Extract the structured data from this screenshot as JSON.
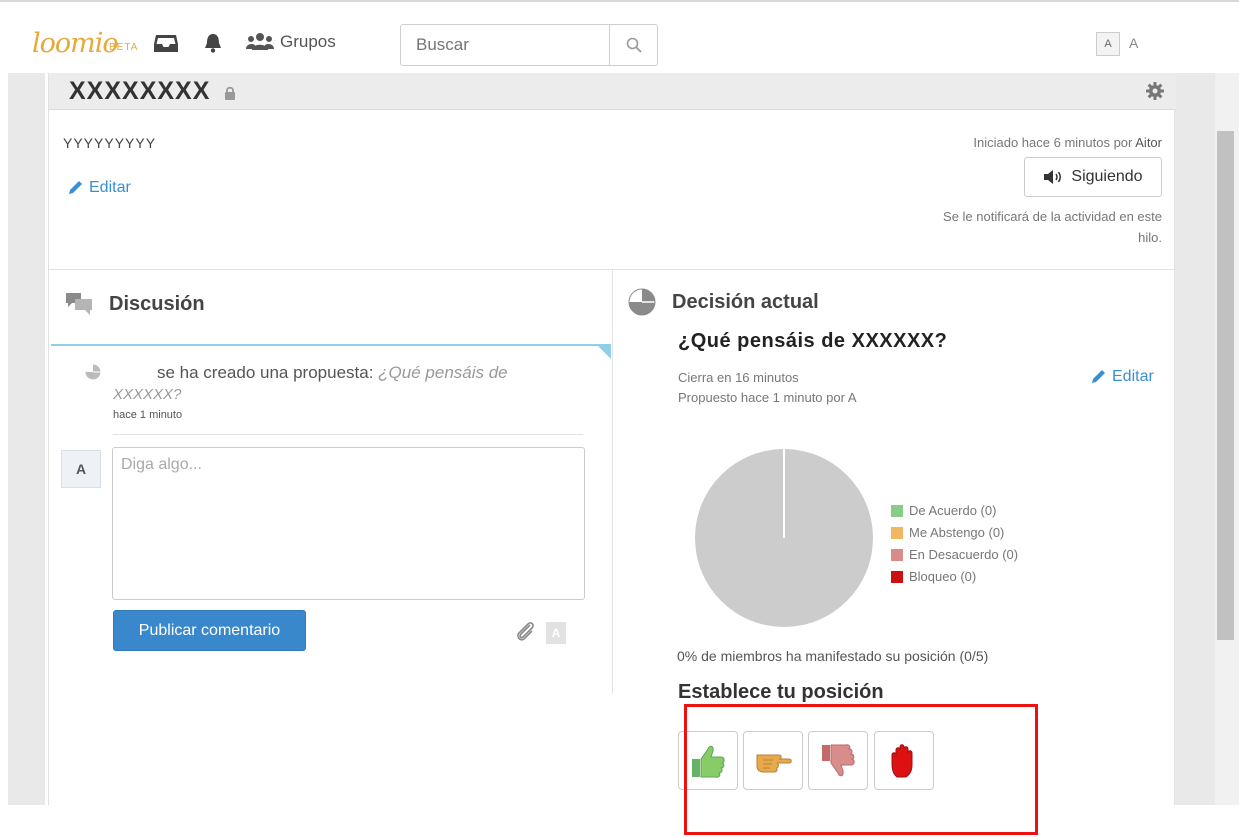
{
  "header": {
    "logo": "loomio",
    "logo_badge": "BETA",
    "groups_label": "Grupos",
    "search_placeholder": "Buscar",
    "user_initial": "A",
    "user_name": "A"
  },
  "thread": {
    "title": "XXXXXXXX",
    "context": "YYYYYYYYY",
    "edit_label": "Editar",
    "started": "Iniciado hace 6 minutos por",
    "started_by": "Aitor",
    "follow_label": "Siguiendo",
    "notify_text": "Se le notificará de la actividad en este hilo."
  },
  "discussion": {
    "heading": "Discusión",
    "event_text": "se ha creado una propuesta:",
    "event_proposal_a": "¿Qué pensáis de",
    "event_proposal_b": "XXXXXX?",
    "event_time": "hace 1 minuto",
    "avatar_initial": "A",
    "comment_placeholder": "Diga algo...",
    "publish_label": "Publicar comentario",
    "markdown_label": "A"
  },
  "decision": {
    "heading": "Decisión actual",
    "proposal_title": "¿Qué pensáis de XXXXXX?",
    "closes": "Cierra en 16 minutos",
    "proposed": "Propuesto hace 1 minuto por A",
    "edit_label": "Editar",
    "legend": [
      {
        "label": "De Acuerdo (0)",
        "color": "#88cc88"
      },
      {
        "label": "Me Abstengo (0)",
        "color": "#f0b860"
      },
      {
        "label": "En Desacuerdo (0)",
        "color": "#d88c8c"
      },
      {
        "label": "Bloqueo (0)",
        "color": "#cc1111"
      }
    ],
    "members_text": "0% de miembros ha manifestado su posición (0/5)",
    "position_heading": "Establece tu posición",
    "positions": [
      "agree",
      "abstain",
      "disagree",
      "block"
    ]
  },
  "colors": {
    "accent": "#3a88cc",
    "highlight": "#ee1111",
    "pie_empty": "#cccccc"
  }
}
